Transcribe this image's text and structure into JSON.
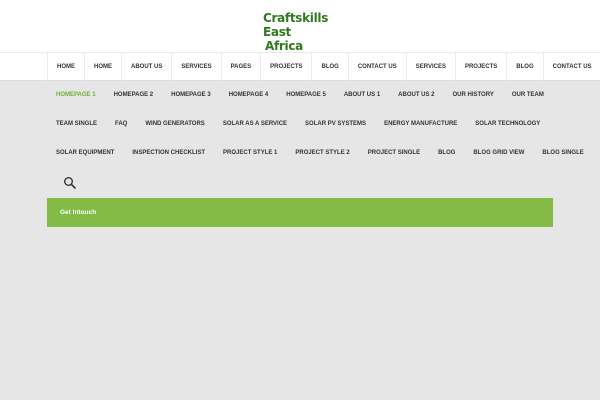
{
  "logo": {
    "line1": "Craftskills East",
    "line2": "Africa Limited"
  },
  "topnav": {
    "items": [
      "HOME",
      "HOME",
      "ABOUT US",
      "SERVICES",
      "PAGES",
      "PROJECTS",
      "BLOG",
      "CONTACT US",
      "SERVICES",
      "PROJECTS",
      "BLOG",
      "CONTACT US"
    ]
  },
  "subnav": {
    "rows": [
      [
        "HOMEPAGE 1",
        "HOMEPAGE 2",
        "HOMEPAGE 3",
        "HOMEPAGE 4",
        "HOMEPAGE 5",
        "ABOUT US 1",
        "ABOUT US 2",
        "OUR HISTORY",
        "OUR TEAM"
      ],
      [
        "TEAM SINGLE",
        "FAQ",
        "WIND GENERATORS",
        "SOLAR AS A SERVICE",
        "SOLAR PV SYSTEMS",
        "ENERGY MANUFACTURE",
        "SOLAR TECHNOLOGY"
      ],
      [
        "SOLAR EQUIPMENT",
        "INSPECTION CHECKLIST",
        "PROJECT STYLE 1",
        "PROJECT STYLE 2",
        "PROJECT SINGLE",
        "BLOG",
        "BLOG GRID VIEW",
        "BLOG SINGLE"
      ]
    ],
    "active": "HOMEPAGE 1",
    "search_icon": "search-icon"
  },
  "cta": {
    "label": "Get Intouch"
  },
  "colors": {
    "brand_green": "#2f7a1e",
    "accent_green": "#83bb46",
    "active_text": "#6fae3a",
    "background": "#e6e6e6"
  }
}
